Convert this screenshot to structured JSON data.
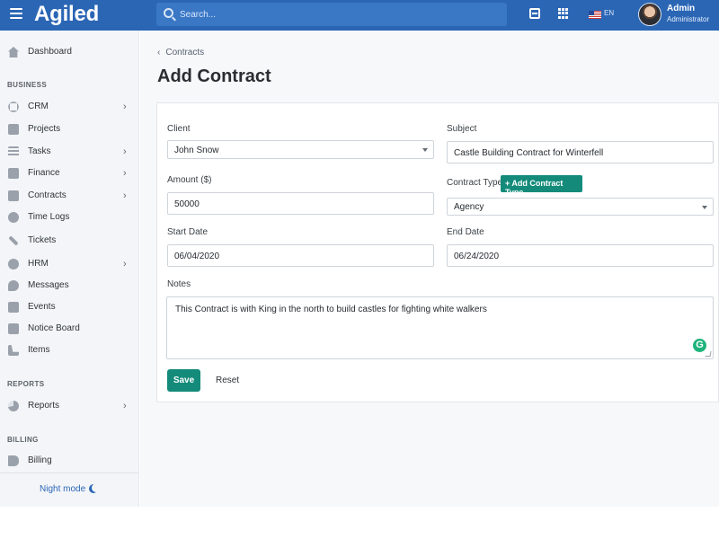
{
  "topbar": {
    "brand": "Agiled",
    "search_placeholder": "Search...",
    "language": "EN",
    "user_name": "Admin",
    "user_role": "Administrator"
  },
  "sidebar": {
    "dashboard": "Dashboard",
    "business_section": "BUSINESS",
    "items": [
      {
        "label": "CRM",
        "icon": "user-icon",
        "chevron": true
      },
      {
        "label": "Projects",
        "icon": "projects-icon",
        "chevron": false
      },
      {
        "label": "Tasks",
        "icon": "tasks-icon",
        "chevron": true
      },
      {
        "label": "Finance",
        "icon": "finance-icon",
        "chevron": true
      },
      {
        "label": "Contracts",
        "icon": "contracts-icon",
        "chevron": true
      },
      {
        "label": "Time Logs",
        "icon": "clock-icon",
        "chevron": false
      },
      {
        "label": "Tickets",
        "icon": "wrench-icon",
        "chevron": false
      },
      {
        "label": "HRM",
        "icon": "hrm-icon",
        "chevron": true
      },
      {
        "label": "Messages",
        "icon": "chat-icon",
        "chevron": false
      },
      {
        "label": "Events",
        "icon": "calendar-icon",
        "chevron": false
      },
      {
        "label": "Notice Board",
        "icon": "notice-icon",
        "chevron": false
      },
      {
        "label": "Items",
        "icon": "cart-icon",
        "chevron": false
      }
    ],
    "reports_section": "REPORTS",
    "reports_label": "Reports",
    "billing_section": "BILLING",
    "billing_label": "Billing",
    "night_mode": "Night mode"
  },
  "page": {
    "breadcrumb": "Contracts",
    "title": "Add Contract"
  },
  "form": {
    "client_label": "Client",
    "client_value": "John Snow",
    "subject_label": "Subject",
    "subject_value": "Castle Building Contract for Winterfell",
    "amount_label": "Amount ($)",
    "amount_value": "50000",
    "contract_type_label": "Contract Type",
    "add_contract_type": "+ Add Contract Type",
    "contract_type_value": "Agency",
    "start_date_label": "Start Date",
    "start_date_value": "06/04/2020",
    "end_date_label": "End Date",
    "end_date_value": "06/24/2020",
    "notes_label": "Notes",
    "notes_value": "This Contract is with King in the north to build castles for fighting white walkers",
    "save": "Save",
    "reset": "Reset"
  },
  "colors": {
    "topbar": "#2b66b5",
    "primary_button": "#148b7a",
    "sidebar": "#f3f5f8",
    "accent_text": "#2b66b5"
  }
}
